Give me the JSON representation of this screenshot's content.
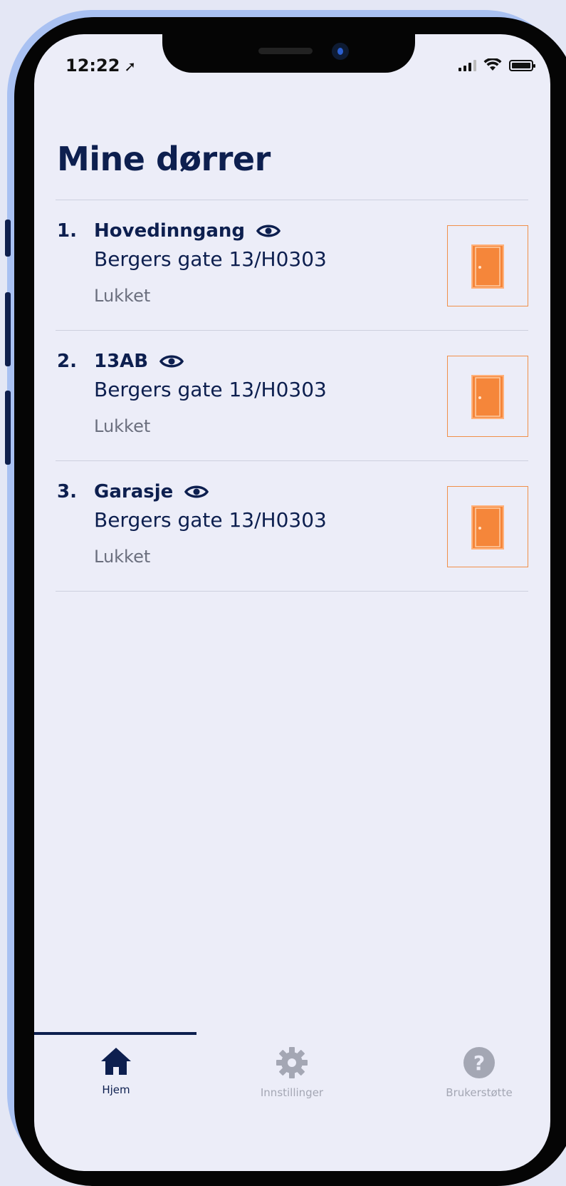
{
  "status_bar": {
    "time": "12:22",
    "location_arrow": "location-arrow-icon",
    "icons": [
      "cellular-signal-icon",
      "wifi-icon",
      "battery-icon"
    ]
  },
  "page": {
    "title": "Mine dørrer"
  },
  "doors": [
    {
      "index": "1.",
      "name": "Hovedinngang",
      "address": "Bergers gate 13/H0303",
      "status": "Lukket"
    },
    {
      "index": "2.",
      "name": "13AB",
      "address": "Bergers gate 13/H0303",
      "status": "Lukket"
    },
    {
      "index": "3.",
      "name": "Garasje",
      "address": "Bergers gate 13/H0303",
      "status": "Lukket"
    }
  ],
  "tabs": [
    {
      "label": "Hjem",
      "icon": "home-icon",
      "active": true
    },
    {
      "label": "Innstillinger",
      "icon": "gear-icon",
      "active": false
    },
    {
      "label": "Brukerstøtte",
      "icon": "help-icon",
      "active": false
    }
  ],
  "colors": {
    "primary": "#0d1f4f",
    "accent": "#f0904a",
    "background": "#ecedf8",
    "muted": "#6b6f7e"
  }
}
